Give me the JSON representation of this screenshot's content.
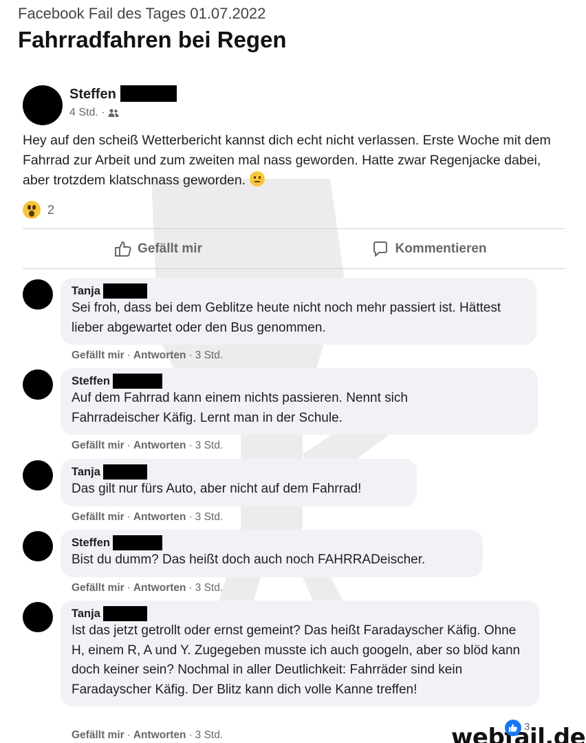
{
  "header": {
    "kicker": "Facebook Fail des Tages 01.07.2022",
    "title": "Fahrradfahren bei Regen"
  },
  "post": {
    "author": "Steffen",
    "time": "4 Std. ·",
    "privacy_icon": "friends-icon",
    "text": "Hey auf den scheiß Wetterbericht kannst dich echt nicht verlassen. Erste Woche mit dem Fahrrad zur Arbeit und zum zweiten mal nass geworden. Hatte zwar Regenjacke dabei, aber trotzdem klatschnass geworden.",
    "text_emoji": "sad-face-emoji",
    "reaction_icon": "wow-reaction-icon",
    "reaction_count": "2",
    "actions": {
      "like": "Gefällt mir",
      "comment": "Kommentieren"
    }
  },
  "comment_actions": {
    "like": "Gefällt mir",
    "reply": "Antworten",
    "sep": "·"
  },
  "comments": [
    {
      "author": "Tanja",
      "text": "Sei froh, dass bei dem Geblitze heute nicht noch mehr passiert ist. Hättest lieber abgewartet oder den Bus genommen.",
      "time": "3 Std."
    },
    {
      "author": "Steffen",
      "text": "Auf dem Fahrrad kann einem nichts passieren. Nennt sich Fahrradeischer Käfig. Lernt man in der Schule.",
      "time": "3 Std."
    },
    {
      "author": "Tanja",
      "text": "Das gilt nur fürs Auto, aber nicht auf dem Fahrrad!",
      "time": "3 Std."
    },
    {
      "author": "Steffen",
      "text": "Bist du dumm? Das heißt doch auch noch FAHRRADeischer.",
      "time": "3 Std."
    },
    {
      "author": "Tanja",
      "text": "Ist das jetzt getrollt oder ernst gemeint? Das heißt Faradayscher Käfig. Ohne H, einem R, A und Y. Zugegeben musste ich auch googeln, aber so blöd kann doch keiner sein? Nochmal in aller Deutlichkeit: Fahrräder sind kein Faradayscher Käfig. Der Blitz kann dich volle Kanne treffen!",
      "time": "3 Std.",
      "like_count": "3"
    }
  ],
  "logo": "webfail.de",
  "colors": {
    "bubble": "#f0f2f5",
    "meta": "#65676b",
    "like_blue": "#1877f2"
  }
}
